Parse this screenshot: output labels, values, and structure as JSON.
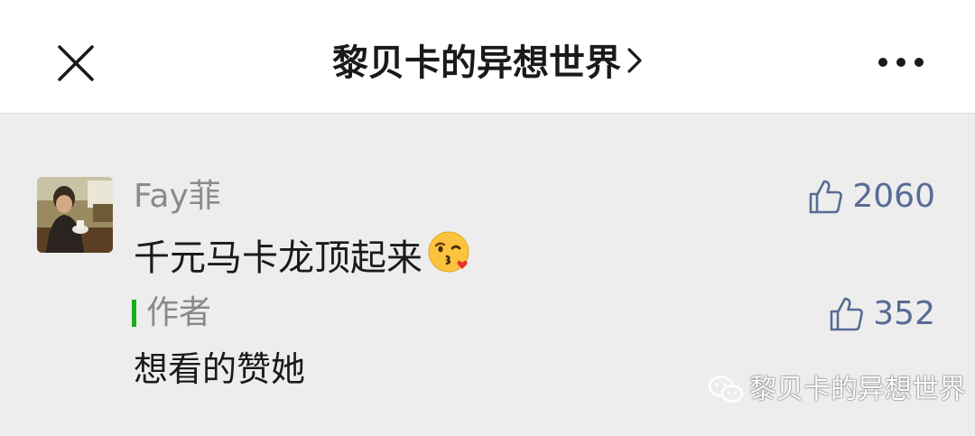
{
  "navbar": {
    "title": "黎贝卡的异想世界",
    "close_icon": "close-icon",
    "chevron_icon": "chevron-right-icon",
    "more_icon": "more-icon"
  },
  "comment": {
    "username": "Fay菲",
    "text": "千元马卡龙顶起来",
    "emoji": "kissing-face-with-heart-emoji",
    "likes": "2060",
    "reply": {
      "author": "作者",
      "text": "想看的赞她",
      "likes": "352"
    }
  },
  "watermark": {
    "text": "黎贝卡的异想世界",
    "icon": "wechat-icon"
  },
  "colors": {
    "like_blue": "#576b95",
    "author_bar_green": "#1aad19",
    "background": "#ededed",
    "navbar": "#ffffff"
  }
}
